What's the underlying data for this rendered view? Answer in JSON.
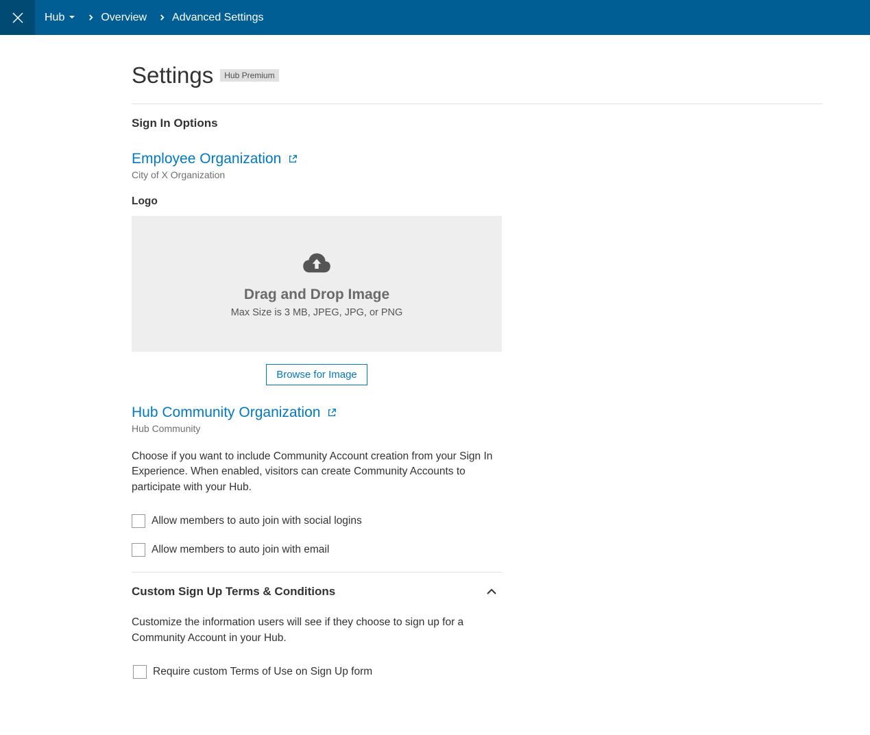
{
  "nav": {
    "hub_label": "Hub",
    "overview_label": "Overview",
    "advanced_label": "Advanced Settings"
  },
  "page": {
    "title": "Settings",
    "badge": "Hub Premium"
  },
  "signin": {
    "heading": "Sign In Options",
    "employee": {
      "link": "Employee Organization",
      "sub": "City of X Organization",
      "logo_label": "Logo",
      "drop_title": "Drag and Drop Image",
      "drop_sub": "Max Size is 3 MB, JPEG, JPG, or PNG",
      "browse_btn": "Browse for Image"
    },
    "community": {
      "link": "Hub Community Organization",
      "sub": "Hub Community",
      "desc": "Choose if you want to include Community Account creation from your Sign In Experience. When enabled, visitors can create Community Accounts to participate with your Hub.",
      "checkbox_social": "Allow members to auto join with social logins",
      "checkbox_email": "Allow members to auto join with email"
    },
    "terms": {
      "title": "Custom Sign Up Terms & Conditions",
      "desc": "Customize the information users will see if they choose to sign up for a Community Account in your Hub.",
      "checkbox_require": "Require custom Terms of Use on Sign Up form"
    }
  }
}
